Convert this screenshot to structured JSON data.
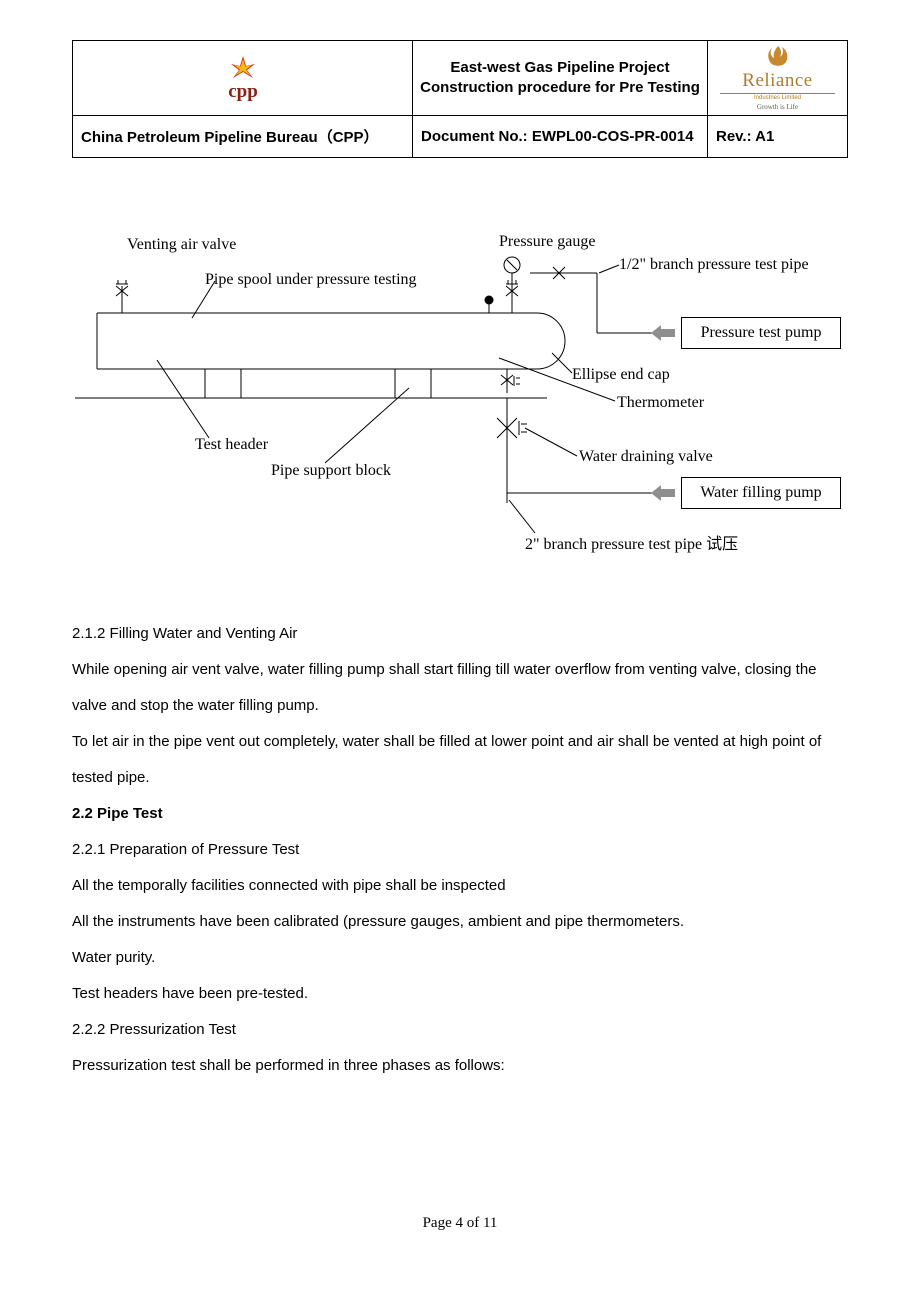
{
  "header": {
    "title_line1": "East-west Gas Pipeline Project",
    "title_line2": "Construction procedure for Pre Testing",
    "org": "China Petroleum Pipeline Bureau（CPP）",
    "doc_no": "Document No.: EWPL00-COS-PR-0014",
    "rev": "Rev.: A1",
    "cpp_text": "cpp",
    "reliance_name": "Reliance",
    "reliance_sub": "Industries Limited",
    "reliance_tag": "Growth is Life"
  },
  "diagram": {
    "venting_air_valve": "Venting air valve",
    "pipe_spool": "Pipe spool under pressure testing",
    "pressure_gauge": "Pressure gauge",
    "branch_half": "1/2\" branch pressure test pipe",
    "pressure_pump": "Pressure test pump",
    "ellipse_cap": "Ellipse end cap",
    "thermometer": "Thermometer",
    "test_header": "Test header",
    "pipe_support": "Pipe support block",
    "water_drain": "Water draining valve",
    "water_pump": "Water filling pump",
    "branch_two": "2\" branch pressure test pipe 试压"
  },
  "body": {
    "s212_h": "2.1.2 Filling Water and Venting Air",
    "s212_p1": "While opening air vent valve, water filling pump shall start filling till water overflow from venting valve, closing the valve and stop the water filling pump.",
    "s212_p2": "To let air in the pipe vent out completely, water shall be filled at lower point and air shall be vented at high point of   tested pipe.",
    "s22_h": "2.2 Pipe Test",
    "s221_h": "2.2.1 Preparation of Pressure Test",
    "s221_p1": "All the temporally facilities connected with pipe shall be inspected",
    "s221_p2": "All the instruments have been calibrated (pressure gauges, ambient and pipe thermometers.",
    "s221_p3": "Water purity.",
    "s221_p4": "Test headers have been pre-tested.",
    "s222_h": "2.2.2 Pressurization Test",
    "s222_p1": "Pressurization test shall be performed in three phases as follows:"
  },
  "footer": "Page 4 of 11"
}
